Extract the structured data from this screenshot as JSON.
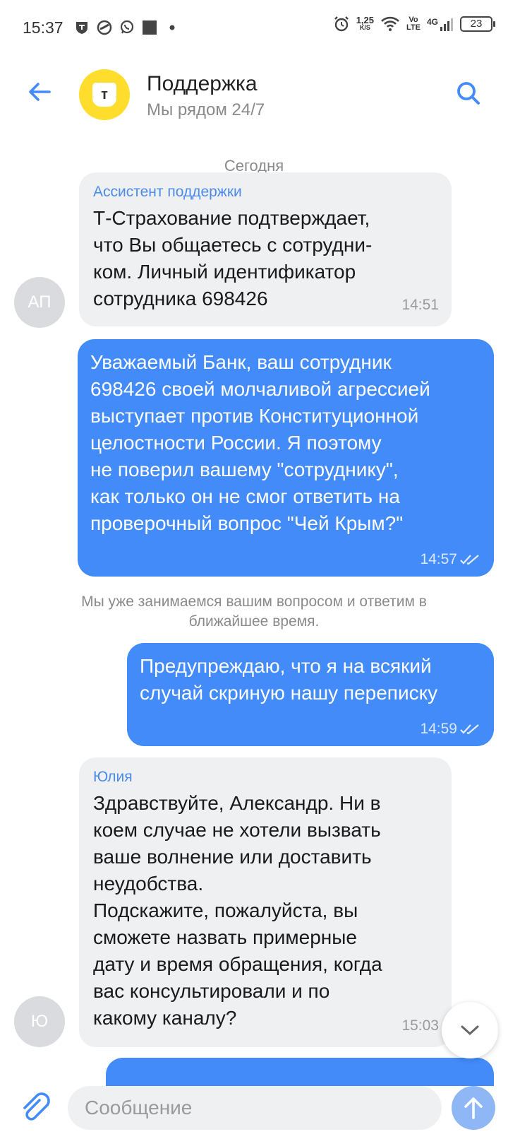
{
  "status_bar": {
    "time": "15:37",
    "speed_value": "1,25",
    "speed_unit": "K/S",
    "volte_top": "Vo",
    "volte_bottom": "LTE",
    "network": "4G",
    "battery": "23",
    "icons": [
      "shield-icon",
      "swirl-icon",
      "whatsapp-icon",
      "square-icon",
      "dot-icon",
      "alarm-icon",
      "wifi-icon",
      "signal-icon"
    ]
  },
  "header": {
    "title": "Поддержка",
    "subtitle": "Мы рядом 24/7",
    "logo_letter": "т",
    "brand_color": "#FFDD2D",
    "accent_color": "#428BF9"
  },
  "chat": {
    "date_label": "Сегодня",
    "messages": [
      {
        "direction": "in",
        "sender": "Ассистент поддержки",
        "avatar": "АП",
        "text": "Т-Страхование подтверждает,\nчто Вы общаетесь с сотрудни-\nком. Личный идентификатор\nсотрудника 698426",
        "time": "14:51"
      },
      {
        "direction": "out",
        "text": "Уважаемый Банк, ваш сотрудник\n698426 своей молчаливой агрессией\nвыступает против Конституционной\nцелостности России. Я поэтому\nне поверил вашему \"сотруднику\",\nкак только он не смог ответить на\nпроверочный вопрос \"Чей Крым?\"",
        "time": "14:57",
        "read": true
      },
      {
        "direction": "out",
        "text": "Предупреждаю, что я на всякий\nслучай скриную нашу переписку",
        "time": "14:59",
        "read": true
      },
      {
        "direction": "in",
        "sender": "Юлия",
        "avatar": "Ю",
        "text": "Здравствуйте, Александр. Ни в\nкоем случае не хотели вызвать\nваше волнение или доставить\nнеудобства.\nПодскажите, пожалуйста, вы\nсможете назвать примерные\nдату и время обращения, когда\nвас консультировали и по\nкакому каналу?",
        "time": "15:03"
      }
    ],
    "system_note": "Мы уже занимаемся вашим вопросом и ответим в\nближайшее время."
  },
  "input": {
    "placeholder": "Сообщение"
  }
}
